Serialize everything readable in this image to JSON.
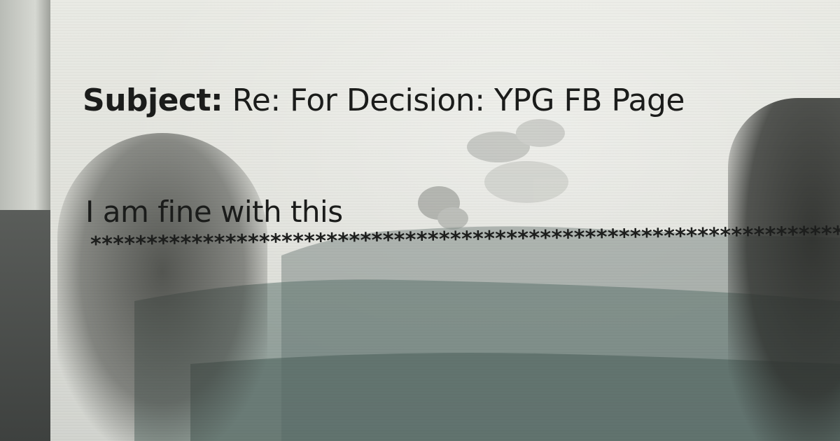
{
  "email": {
    "subject_label": "Subject:",
    "subject_text": "Re: For Decision: YPG FB Page",
    "body": "I am fine with this",
    "separator": "**********************************************************************"
  },
  "colors": {
    "text": "#1b1c1b",
    "window_background": "#e4e5df"
  }
}
